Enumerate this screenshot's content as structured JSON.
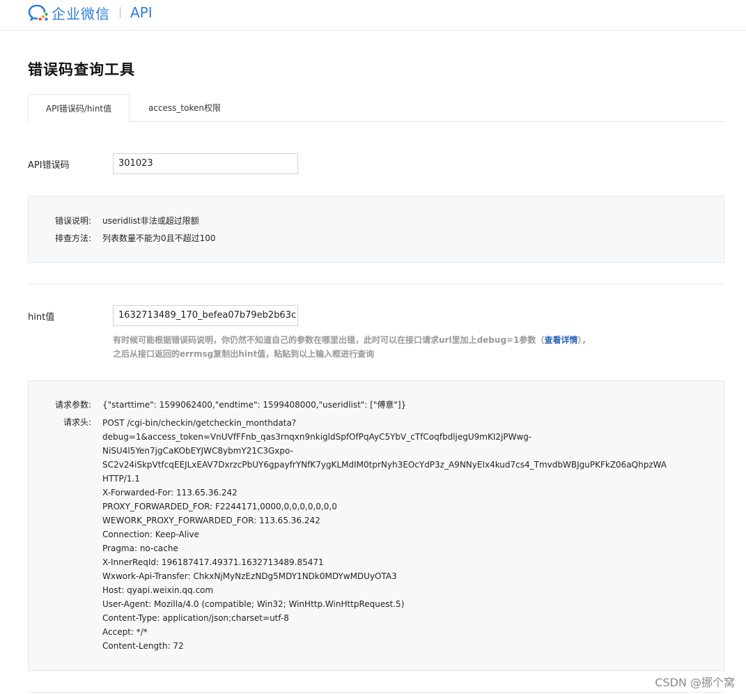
{
  "header": {
    "brand": "企业微信",
    "section": "API"
  },
  "page": {
    "title": "错误码查询工具"
  },
  "tabs": [
    {
      "label": "API错误码/hint值",
      "active": true
    },
    {
      "label": "access_token权限",
      "active": false
    }
  ],
  "errcode": {
    "label": "API错误码",
    "value": "301023"
  },
  "error_info": {
    "desc_key": "错误说明:",
    "desc_val": "useridlist非法或超过限额",
    "fix_key": "排查方法:",
    "fix_val": "列表数量不能为0且不超过100"
  },
  "hint": {
    "label": "hint值",
    "value": "1632713489_170_befea07b79eb2b63c",
    "desc_line1_pre": "有时候可能根据错误码说明，你仍然不知道自己的参数在哪里出错，此时可以在接口请求url里加上debug=1参数（",
    "desc_link": "查看详情",
    "desc_line1_post": "），",
    "desc_line2": "之后从接口返回的errmsg复制出hint值，粘贴到以上输入框进行查询"
  },
  "request": {
    "params_key": "请求参数:",
    "params_val": "{\"starttime\": 1599062400,\"endtime\": 1599408000,\"useridlist\": [\"傅意\"]}",
    "headers_key": "请求头:",
    "header_lines": [
      "POST /cgi-bin/checkin/getcheckin_monthdata?",
      "debug=1&access_token=VnUVfFFnb_qas3rnqxn9nkigldSpfOfPqAyC5YbV_cTfCoqfbdljegU9mKI2jPWwg-",
      "NiSU4l5Yen7jgCaKObEYJWC8ybmY21C3Gxpo-",
      "SC2v24iSkpVtfcqEEJLxEAV7DxrzcPbUY6gpayfrYNfK7ygKLMdIM0tprNyh3EOcYdP3z_A9NNyEIx4kud7cs4_TmvdbWBJguPKFkZ06aQhpzWA",
      "HTTP/1.1",
      "X-Forwarded-For: 113.65.36.242",
      "PROXY_FORWARDED_FOR: F2244171,0000,0,0,0,0,0,0,0",
      "WEWORK_PROXY_FORWARDED_FOR: 113.65.36.242",
      "Connection: Keep-Alive",
      "Pragma: no-cache",
      "X-InnerReqId: 196187417.49371.1632713489.85471",
      "Wxwork-Api-Transfer: ChkxNjMyNzEzNDg5MDY1NDk0MDYwMDUyOTA3",
      "Host: qyapi.weixin.qq.com",
      "User-Agent: Mozilla/4.0 (compatible; Win32; WinHttp.WinHttpRequest.5)",
      "Content-Type: application/json;charset=utf-8",
      "Accept: */*",
      "Content-Length: 72"
    ]
  },
  "watermark": "CSDN @挪个窝",
  "colors": {
    "brand_blue": "#2f7fd8",
    "link_blue": "#2a66b8",
    "logo_green": "#3cb371",
    "logo_orange": "#f5a623"
  }
}
